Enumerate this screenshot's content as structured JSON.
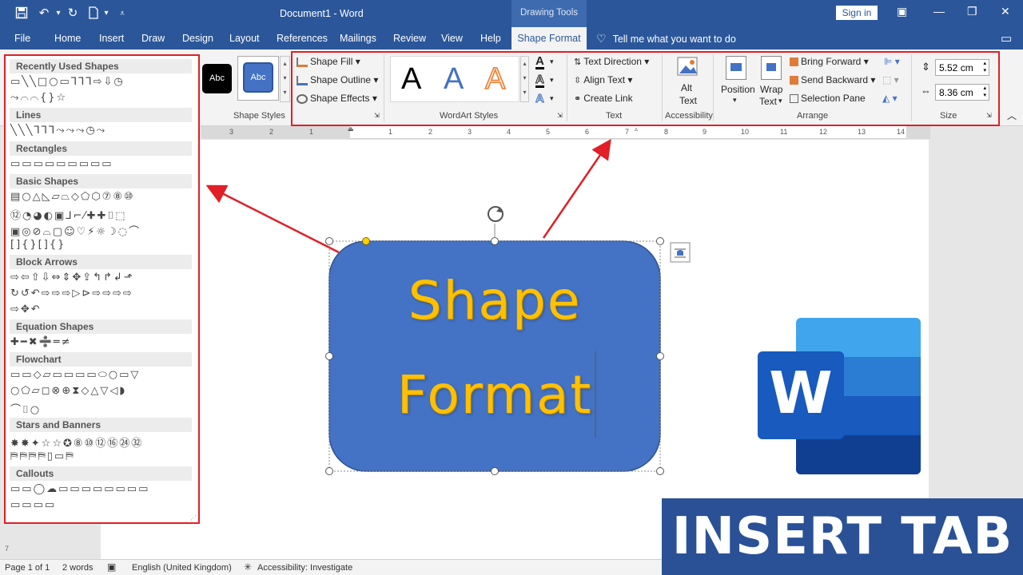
{
  "titlebar": {
    "document_title": "Document1  -  Word",
    "contextual_tab_group": "Drawing Tools",
    "sign_in": "Sign in"
  },
  "menu": {
    "items": [
      "File",
      "Home",
      "Insert",
      "Draw",
      "Design",
      "Layout",
      "References",
      "Mailings",
      "Review",
      "View",
      "Help"
    ],
    "active_tab": "Shape Format",
    "tell_me": "Tell me what you want to do"
  },
  "ribbon": {
    "style_swatches": [
      "Abc",
      "Abc"
    ],
    "shape_styles": {
      "fill": "Shape Fill",
      "outline": "Shape Outline",
      "effects": "Shape Effects",
      "label": "Shape Styles"
    },
    "wordart": {
      "letters": [
        "A",
        "A",
        "A"
      ],
      "label": "WordArt Styles"
    },
    "text_group": {
      "direction": "Text Direction",
      "align": "Align Text",
      "link": "Create Link",
      "label": "Text"
    },
    "accessibility": {
      "alt_line1": "Alt",
      "alt_line2": "Text",
      "label": "Accessibility"
    },
    "arrange": {
      "position": "Position",
      "wrap_line1": "Wrap",
      "wrap_line2": "Text",
      "bring_forward": "Bring Forward",
      "send_backward": "Send Backward",
      "selection_pane": "Selection Pane",
      "label": "Arrange"
    },
    "size": {
      "height": "5.52 cm",
      "width": "8.36 cm",
      "label": "Size"
    }
  },
  "ruler": {
    "ticks": [
      "3",
      "2",
      "1",
      "1",
      "2",
      "3",
      "4",
      "5",
      "6",
      "7",
      "8",
      "9",
      "10",
      "11",
      "12",
      "13",
      "14"
    ]
  },
  "shapes_panel": {
    "categories": [
      {
        "title": "Recently Used Shapes",
        "rows": [
          "▭╲╲□○▭⅂⅂⅂⇨⇩◷",
          "⤳⌒⌒{}☆"
        ]
      },
      {
        "title": "Lines",
        "rows": [
          "╲╲╲⅂⅂⅂⤳⤳⤳◷⤳"
        ]
      },
      {
        "title": "Rectangles",
        "rows": [
          "▭▭▭▭▭▭▭▭▭"
        ]
      },
      {
        "title": "Basic Shapes",
        "rows": [
          "▤○△◺▱⏢◇⬠⬡⑦⑧⑩",
          "⑫◔◕◐▣⅃⌐⁄✚✚⌷⬚",
          "▣◎⊘⌓▢☺♡⚡☼☽◌⌒",
          "[]{}[]{}"
        ]
      },
      {
        "title": "Block Arrows",
        "rows": [
          "⇨⇦⇧⇩⇔⇕✥⇪↰↱↲⬏",
          "↻↺↶⇨⇨⇨▷⊳⇨⇨⇨⇨",
          "⇨✥↶"
        ]
      },
      {
        "title": "Equation Shapes",
        "rows": [
          "✚━✖➗═≠"
        ]
      },
      {
        "title": "Flowchart",
        "rows": [
          "▭▭◇▱▭▭▭▭⬭○▭▽",
          "○⬠▱◻⊗⊕⧗◇△▽◁◗",
          "⌒⌷○"
        ]
      },
      {
        "title": "Stars and Banners",
        "rows": [
          "✸✸✦☆☆✪⑧⑩⑫⑯㉔㉜",
          "⛿⛿⛿⛿▯▭⛿"
        ]
      },
      {
        "title": "Callouts",
        "rows": [
          "▭▭◯☁▭▭▭▭▭▭▭▭",
          "▭▭▭▭"
        ]
      }
    ]
  },
  "canvas": {
    "shape_text_line1": "Shape",
    "shape_text_line2": "Format",
    "word_logo_letter": "W",
    "banner": "INSERT TAB"
  },
  "status": {
    "page": "Page 1 of 1",
    "words": "2 words",
    "language": "English (United Kingdom)",
    "accessibility": "Accessibility: Investigate"
  },
  "colors": {
    "word_blue": "#2b579a",
    "highlight_red": "#e01f26",
    "shape_fill": "#4472c4",
    "shape_text": "#ffc000"
  }
}
